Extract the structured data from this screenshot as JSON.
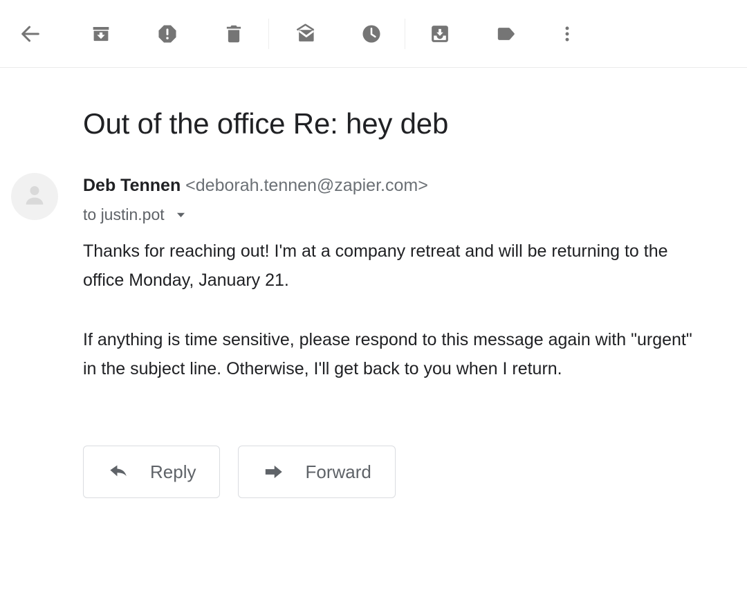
{
  "colors": {
    "icon_gray": "#757575",
    "text_primary": "#202124",
    "text_secondary": "#5f6368",
    "divider": "#ebebeb",
    "button_border": "#dadce0",
    "avatar_bg": "#f1f1f1",
    "avatar_fg": "#d8d8d8",
    "background": "#ffffff"
  },
  "toolbar": {
    "back": {
      "label": "Back to Inbox",
      "icon": "arrow-left-icon"
    },
    "items": [
      {
        "name": "archive",
        "label": "Archive",
        "icon": "archive-icon"
      },
      {
        "name": "report-spam",
        "label": "Report spam",
        "icon": "report-spam-icon"
      },
      {
        "name": "delete",
        "label": "Delete",
        "icon": "trash-icon"
      },
      {
        "name": "mark-unread",
        "label": "Mark as unread",
        "icon": "mark-unread-envelope-icon"
      },
      {
        "name": "snooze",
        "label": "Snooze",
        "icon": "clock-icon"
      },
      {
        "name": "move-to",
        "label": "Move to",
        "icon": "move-to-inbox-icon"
      },
      {
        "name": "labels",
        "label": "Labels",
        "icon": "label-tag-icon"
      },
      {
        "name": "more",
        "label": "More",
        "icon": "more-vertical-icon"
      }
    ]
  },
  "message": {
    "subject": "Out of the office Re: hey deb",
    "sender": {
      "name": "Deb Tennen",
      "email": "<deborah.tennen@zapier.com>"
    },
    "recipient": {
      "text": "to justin.pot",
      "caret_icon": "chevron-down-icon"
    },
    "avatar_icon": "person-placeholder-icon",
    "paragraphs": [
      "Thanks for reaching out! I'm at a company retreat and will be returning to the office Monday, January 21.",
      "If anything is time sensitive, please respond to this message again with \"urgent\" in the subject line. Otherwise, I'll get back to you when I return."
    ]
  },
  "actions": {
    "reply": {
      "label": "Reply",
      "icon": "reply-arrow-icon"
    },
    "forward": {
      "label": "Forward",
      "icon": "forward-arrow-icon"
    }
  }
}
